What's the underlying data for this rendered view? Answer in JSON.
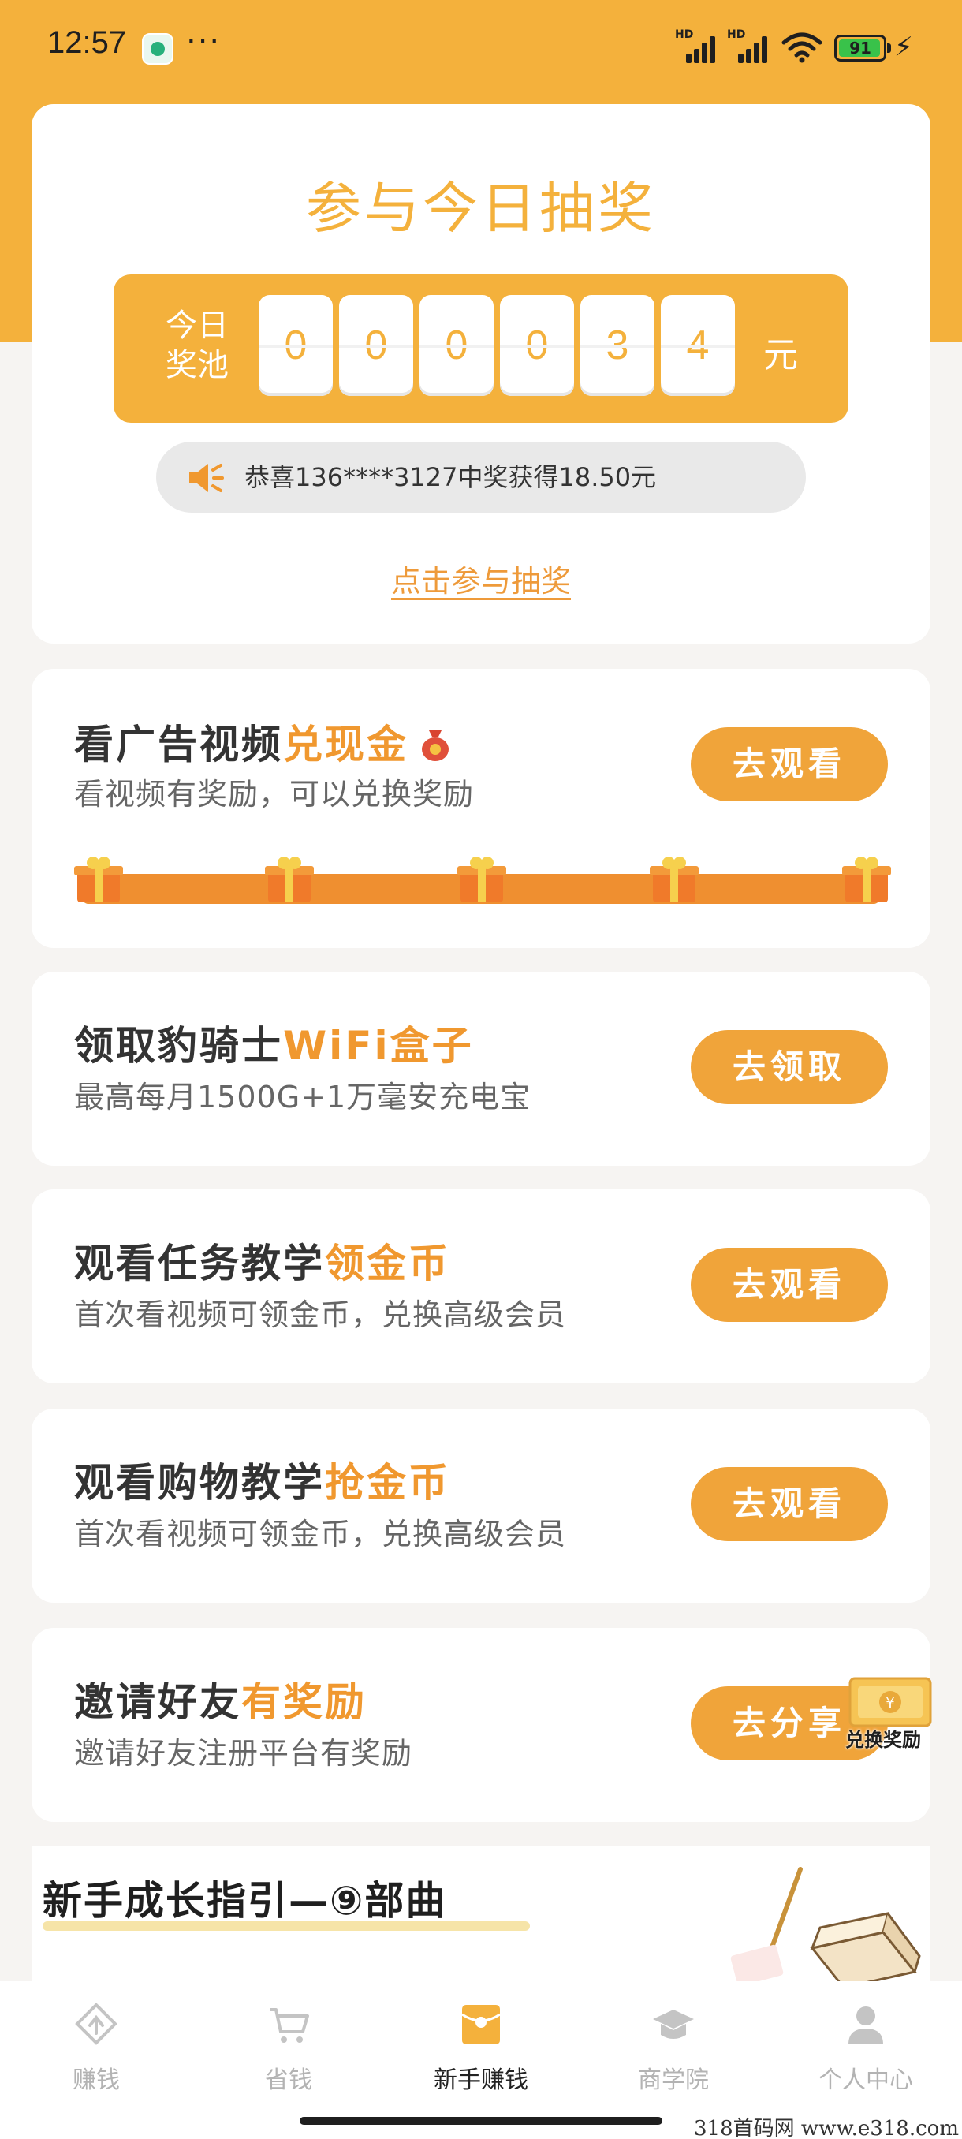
{
  "status_bar": {
    "time": "12:57",
    "more": "···",
    "battery": "91",
    "hd1": "HD",
    "hd2": "HD"
  },
  "lottery": {
    "title": "参与今日抽奖",
    "pool_label": "今日奖池",
    "digits": [
      "0",
      "0",
      "0",
      "0",
      "3",
      "4"
    ],
    "unit": "元",
    "ticker": "恭喜136****3127中奖获得18.50元",
    "join_link": "点击参与抽奖"
  },
  "tasks": [
    {
      "title_main": "看广告视频",
      "title_hl": "兑现金",
      "subtitle": "看视频有奖励，可以兑换奖励",
      "button": "去观看"
    },
    {
      "title_main": "领取豹骑士",
      "title_hl": "WiFi盒子",
      "subtitle": "最高每月1500G+1万毫安充电宝",
      "button": "去领取"
    },
    {
      "title_main": "观看任务教学",
      "title_hl": "领金币",
      "subtitle": "首次看视频可领金币，兑换高级会员",
      "button": "去观看"
    },
    {
      "title_main": "观看购物教学",
      "title_hl": "抢金币",
      "subtitle": "首次看视频可领金币，兑换高级会员",
      "button": "去观看"
    },
    {
      "title_main": "邀请好友",
      "title_hl": "有奖励",
      "subtitle": "邀请好友注册平台有奖励",
      "button": "去分享"
    }
  ],
  "floating": {
    "label": "兑换奖励"
  },
  "guide": {
    "title": "新手成长指引—⑨部曲"
  },
  "nav": [
    {
      "label": "赚钱",
      "icon": "earn-icon",
      "active": false
    },
    {
      "label": "省钱",
      "icon": "cart-icon",
      "active": false
    },
    {
      "label": "新手赚钱",
      "icon": "red-envelope-icon",
      "active": true
    },
    {
      "label": "商学院",
      "icon": "graduation-cap-icon",
      "active": false
    },
    {
      "label": "个人中心",
      "icon": "person-icon",
      "active": false
    }
  ],
  "watermark": "318首码网  www.e318.com",
  "colors": {
    "brand": "#f4b13c",
    "accent": "#f0982f",
    "button": "#f0a43a",
    "progress": "#ef8f30"
  }
}
